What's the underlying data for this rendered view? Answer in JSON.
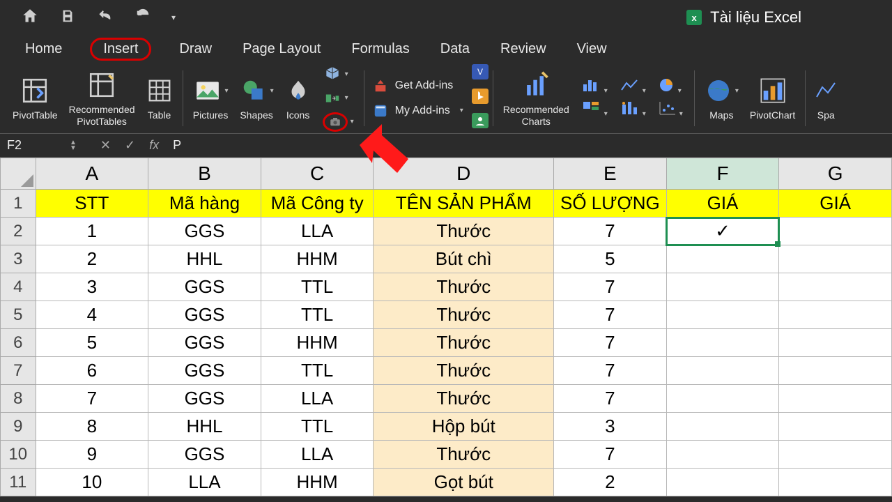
{
  "app": {
    "doc_title": "Tài liệu Excel"
  },
  "tabs": [
    "Home",
    "Insert",
    "Draw",
    "Page Layout",
    "Formulas",
    "Data",
    "Review",
    "View"
  ],
  "active_tab": "Insert",
  "ribbon": {
    "pivot": "PivotTable",
    "recpivot_l1": "Recommended",
    "recpivot_l2": "PivotTables",
    "table": "Table",
    "pictures": "Pictures",
    "shapes": "Shapes",
    "icons": "Icons",
    "getaddins": "Get Add-ins",
    "myaddins": "My Add-ins",
    "reccharts_l1": "Recommended",
    "reccharts_l2": "Charts",
    "maps": "Maps",
    "pivotchart": "PivotChart",
    "spark": "Spa"
  },
  "formula": {
    "namebox": "F2",
    "value": "P"
  },
  "columns": [
    "A",
    "B",
    "C",
    "D",
    "E",
    "F",
    "G"
  ],
  "headers": {
    "A": "STT",
    "B": "Mã hàng",
    "C": "Mã Công ty",
    "D": "TÊN SẢN PHẨM",
    "E": "SỐ LƯỢNG",
    "F": "GIÁ",
    "G": "GIÁ"
  },
  "selected_cell_value": "✓",
  "rows": [
    {
      "n": "1",
      "A": "1",
      "B": "GGS",
      "C": "LLA",
      "D": "Thước",
      "E": "7"
    },
    {
      "n": "2",
      "A": "2",
      "B": "HHL",
      "C": "HHM",
      "D": "Bút chì",
      "E": "5"
    },
    {
      "n": "3",
      "A": "3",
      "B": "GGS",
      "C": "TTL",
      "D": "Thước",
      "E": "7"
    },
    {
      "n": "4",
      "A": "4",
      "B": "GGS",
      "C": "TTL",
      "D": "Thước",
      "E": "7"
    },
    {
      "n": "5",
      "A": "5",
      "B": "GGS",
      "C": "HHM",
      "D": "Thước",
      "E": "7"
    },
    {
      "n": "6",
      "A": "6",
      "B": "GGS",
      "C": "TTL",
      "D": "Thước",
      "E": "7"
    },
    {
      "n": "7",
      "A": "7",
      "B": "GGS",
      "C": "LLA",
      "D": "Thước",
      "E": "7"
    },
    {
      "n": "8",
      "A": "8",
      "B": "HHL",
      "C": "TTL",
      "D": "Hộp bút",
      "E": "3"
    },
    {
      "n": "9",
      "A": "9",
      "B": "GGS",
      "C": "LLA",
      "D": "Thước",
      "E": "7"
    },
    {
      "n": "10",
      "A": "10",
      "B": "LLA",
      "C": "HHM",
      "D": "Gọt bút",
      "E": "2"
    }
  ]
}
